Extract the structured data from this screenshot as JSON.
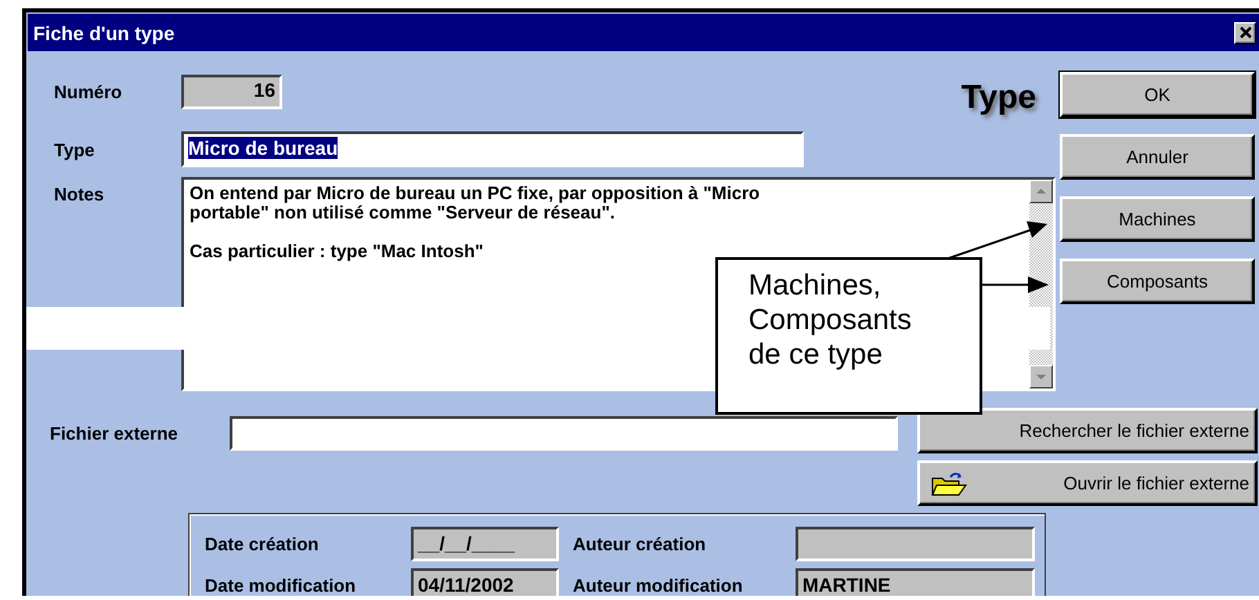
{
  "window": {
    "title": "Fiche d'un type"
  },
  "heading": "Type",
  "fields": {
    "numero": {
      "label": "Numéro",
      "value": "16"
    },
    "type": {
      "label": "Type",
      "value": "Micro de bureau",
      "selected": true
    },
    "notes": {
      "label": "Notes",
      "value": "On entend par Micro de bureau un PC fixe, par opposition à \"Micro\nportable\" non utilisé comme \"Serveur de réseau\".\n\nCas particulier : type \"Mac Intosh\""
    }
  },
  "buttons": [
    {
      "label": "OK",
      "default": true
    },
    {
      "label": "Annuler",
      "default": false
    },
    {
      "label": "Machines",
      "default": false
    },
    {
      "label": "Composants",
      "default": false
    }
  ],
  "external_file": {
    "label": "Fichier externe"
  },
  "file_buttons": [
    {
      "label": "Rechercher le fichier externe",
      "kind": "search"
    },
    {
      "label": "Ouvrir le fichier externe",
      "kind": "open"
    }
  ],
  "audit": {
    "rows": [
      {
        "date_label": "Date création",
        "date": "__/__/____",
        "author_label": "Auteur création"
      },
      {
        "date_label": "Date modification",
        "date": "04/11/2002",
        "author_label": "Auteur modification",
        "author": "MARTINE"
      }
    ]
  },
  "callout": {
    "text": "Machines,\nComposants\nde ce type"
  }
}
